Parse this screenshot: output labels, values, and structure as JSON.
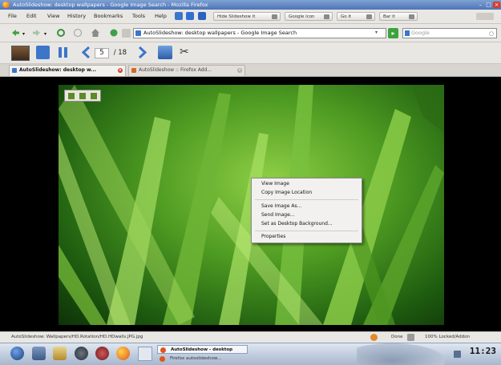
{
  "window": {
    "title": "AutoSlideshow: desktop wallpapers - Google Image Search - Mozilla Firefox"
  },
  "menu": {
    "items": [
      "File",
      "Edit",
      "View",
      "History",
      "Bookmarks",
      "Tools",
      "Help"
    ]
  },
  "menubar_buttons": [
    "Hide Slideshow it",
    "Google icon",
    "Go it",
    "Bar it"
  ],
  "nav": {
    "url": "AutoSlideshow: desktop wallpapers - Google Image Search",
    "search_placeholder": "Google"
  },
  "slideshow": {
    "current_page": "5",
    "total_pages": "/ 18"
  },
  "tabs": [
    {
      "label": "AutoSlideshow: desktop w...",
      "active": true
    },
    {
      "label": "AutoSlideshow :: Firefox Add...",
      "active": false
    }
  ],
  "context_menu": {
    "items": [
      "View Image",
      "Copy Image Location",
      "Save Image As...",
      "Send Image...",
      "Set as Desktop Background...",
      "Properties"
    ]
  },
  "status": {
    "left": "AutoSlideshow: Wallpapers/HD.Rotation/HD.HDwalls.JPG.jpg",
    "middle": "Done",
    "right": "100% Locked/Addon"
  },
  "taskbar": {
    "tasks": [
      "AutoSlideshow - desktop",
      "Firefox autoslideshow..."
    ],
    "clock": "11:23"
  },
  "colors": {
    "titlebar": "#4d74b6",
    "accent": "#3b76c9",
    "close": "#d23b2b"
  }
}
